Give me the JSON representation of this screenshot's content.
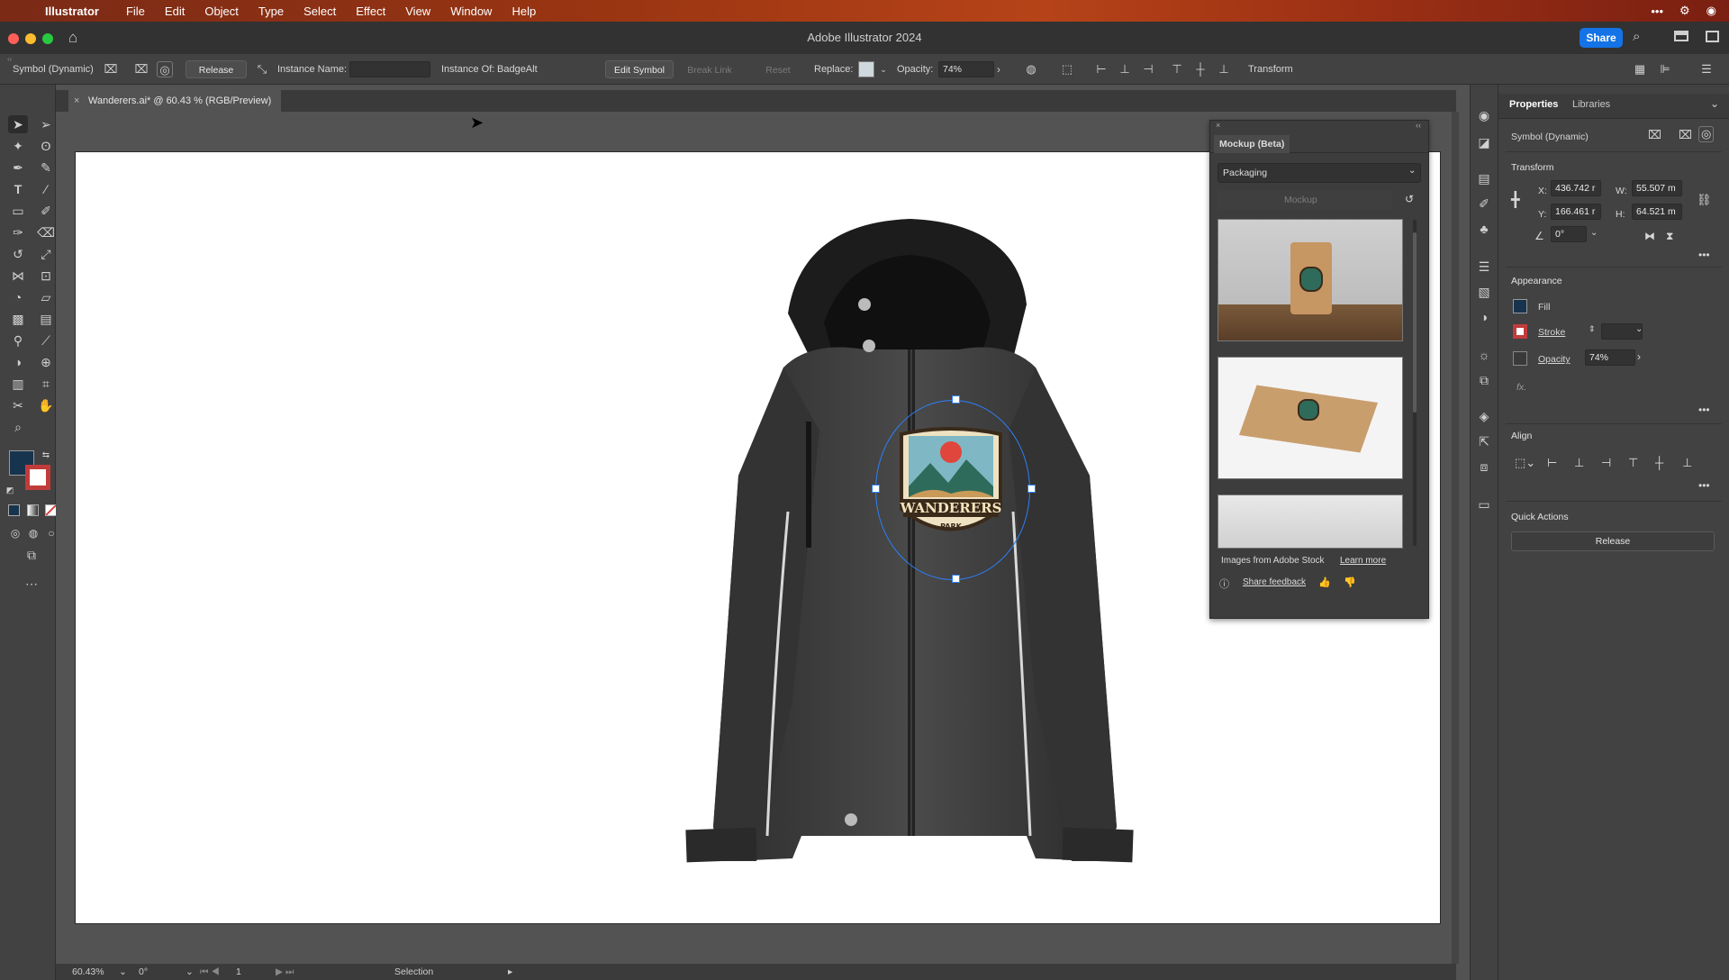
{
  "menubar": {
    "app_name": "Illustrator",
    "items": [
      "File",
      "Edit",
      "Object",
      "Type",
      "Select",
      "Effect",
      "View",
      "Window",
      "Help"
    ]
  },
  "window": {
    "title": "Adobe Illustrator 2024",
    "share_label": "Share"
  },
  "control_bar": {
    "selection_type": "Symbol (Dynamic)",
    "release_label": "Release",
    "instance_name_label": "Instance Name:",
    "instance_name_value": "",
    "instance_of_label": "Instance Of:",
    "instance_of_value": "BadgeAlt",
    "edit_symbol_label": "Edit Symbol",
    "break_link_label": "Break Link",
    "reset_label": "Reset",
    "replace_label": "Replace:",
    "opacity_label": "Opacity:",
    "opacity_value": "74%",
    "transform_label": "Transform"
  },
  "document": {
    "tab_label": "Wanderers.ai* @ 60.43 % (RGB/Preview)",
    "badge_text": "WANDERERS",
    "badge_subtext": "PARK"
  },
  "status_bar": {
    "zoom": "60.43%",
    "rotation": "0°",
    "artboard": "1",
    "tool": "Selection"
  },
  "mockup_panel": {
    "title": "Mockup (Beta)",
    "category": "Packaging",
    "mockup_label": "Mockup",
    "stock_note": "Images from Adobe Stock",
    "learn_more": "Learn more",
    "share_feedback": "Share feedback"
  },
  "properties": {
    "tabs": [
      "Properties",
      "Libraries"
    ],
    "selection_type": "Symbol (Dynamic)",
    "transform_title": "Transform",
    "x_label": "X:",
    "x_value": "436.742 r",
    "y_label": "Y:",
    "y_value": "166.461 r",
    "w_label": "W:",
    "w_value": "55.507 m",
    "h_label": "H:",
    "h_value": "64.521 m",
    "rotation_value": "0°",
    "appearance_title": "Appearance",
    "fill_label": "Fill",
    "stroke_label": "Stroke",
    "opacity_label": "Opacity",
    "opacity_value": "74%",
    "fx_label": "fx.",
    "align_title": "Align",
    "quick_actions_title": "Quick Actions",
    "release_label": "Release"
  },
  "colors": {
    "accent": "#1473e6",
    "fill_swatch": "#17344e",
    "selection": "#2d7ff9"
  }
}
